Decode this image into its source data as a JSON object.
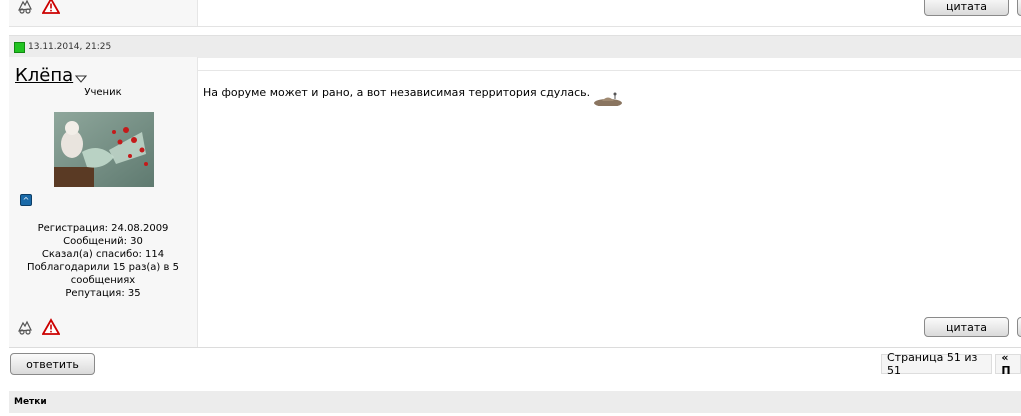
{
  "prev_post": {
    "quote_label": "цитата"
  },
  "post": {
    "date": "13.11.2014, 21:25",
    "username": "Клёпа",
    "user_title": "Ученик",
    "stats": [
      "Регистрация: 24.08.2009",
      "Сообщений: 30",
      "Сказал(а) спасибо: 114",
      "Поблагодарили 15 раз(а) в 5",
      "сообщениях",
      "Репутация: 35"
    ],
    "message": "На форуме может и рано, а вот независимая территория сдулась.",
    "quote_label": "цитата"
  },
  "footer": {
    "reply_label": "ответить",
    "page_info": "Страница 51 из 51",
    "prev_label": "« П",
    "tags_label": "Метки"
  },
  "icons": {
    "online": "online-status-icon",
    "user_menu": "user-menu-arrow-icon",
    "reputation": "reputation-icon",
    "thanks": "thanks-icon",
    "report": "report-icon"
  },
  "colors": {
    "online": "#22c322",
    "header_bg": "#ececec",
    "userinfo_bg": "#f7f7f7"
  }
}
